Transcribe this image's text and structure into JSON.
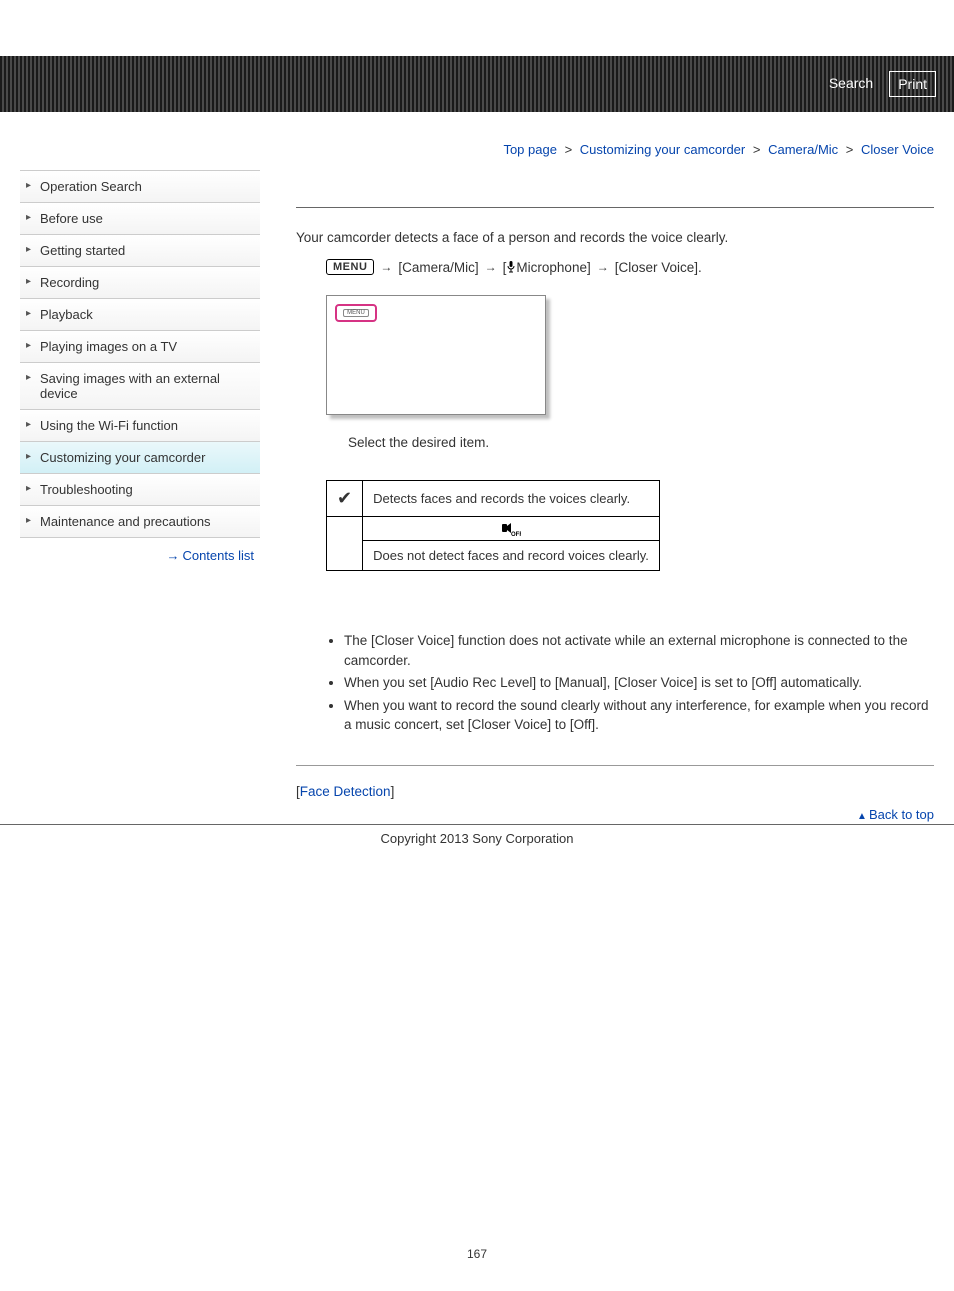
{
  "banner": {
    "search": "Search",
    "print": "Print"
  },
  "sidebar": {
    "items": [
      {
        "label": "Operation Search"
      },
      {
        "label": "Before use"
      },
      {
        "label": "Getting started"
      },
      {
        "label": "Recording"
      },
      {
        "label": "Playback"
      },
      {
        "label": "Playing images on a TV"
      },
      {
        "label": "Saving images with an external device"
      },
      {
        "label": "Using the Wi-Fi function"
      },
      {
        "label": "Customizing your camcorder"
      },
      {
        "label": "Troubleshooting"
      },
      {
        "label": "Maintenance and precautions"
      }
    ],
    "contents_link": "Contents list"
  },
  "breadcrumb": {
    "top": "Top page",
    "l1": "Customizing your camcorder",
    "l2": "Camera/Mic",
    "current": "Closer Voice",
    "sep": ">"
  },
  "content": {
    "intro": "Your camcorder detects a face of a person and records the voice clearly.",
    "menu_label": "MENU",
    "path_seg1": "[Camera/Mic]",
    "path_seg2_pre": "[",
    "path_seg2_post": "Microphone]",
    "path_seg3": "[Closer Voice].",
    "screen_btn": "MENU",
    "step1": "Select the desired item.",
    "option_on_desc": "Detects faces and records the voices clearly.",
    "option_off_desc": "Does not detect faces and record voices clearly.",
    "notes": [
      "The [Closer Voice] function does not activate while an external microphone is connected to the camcorder.",
      "When you set [Audio Rec Level] to [Manual], [Closer Voice] is set to [Off] automatically.",
      "When you want to record the sound clearly without any interference, for example when you record a music concert, set [Closer Voice] to [Off]."
    ],
    "related_pre": "[",
    "related_link": "Face Detection",
    "related_post": "]",
    "back_to_top": "Back to top",
    "copyright": "Copyright 2013 Sony Corporation",
    "page_number": "167"
  }
}
